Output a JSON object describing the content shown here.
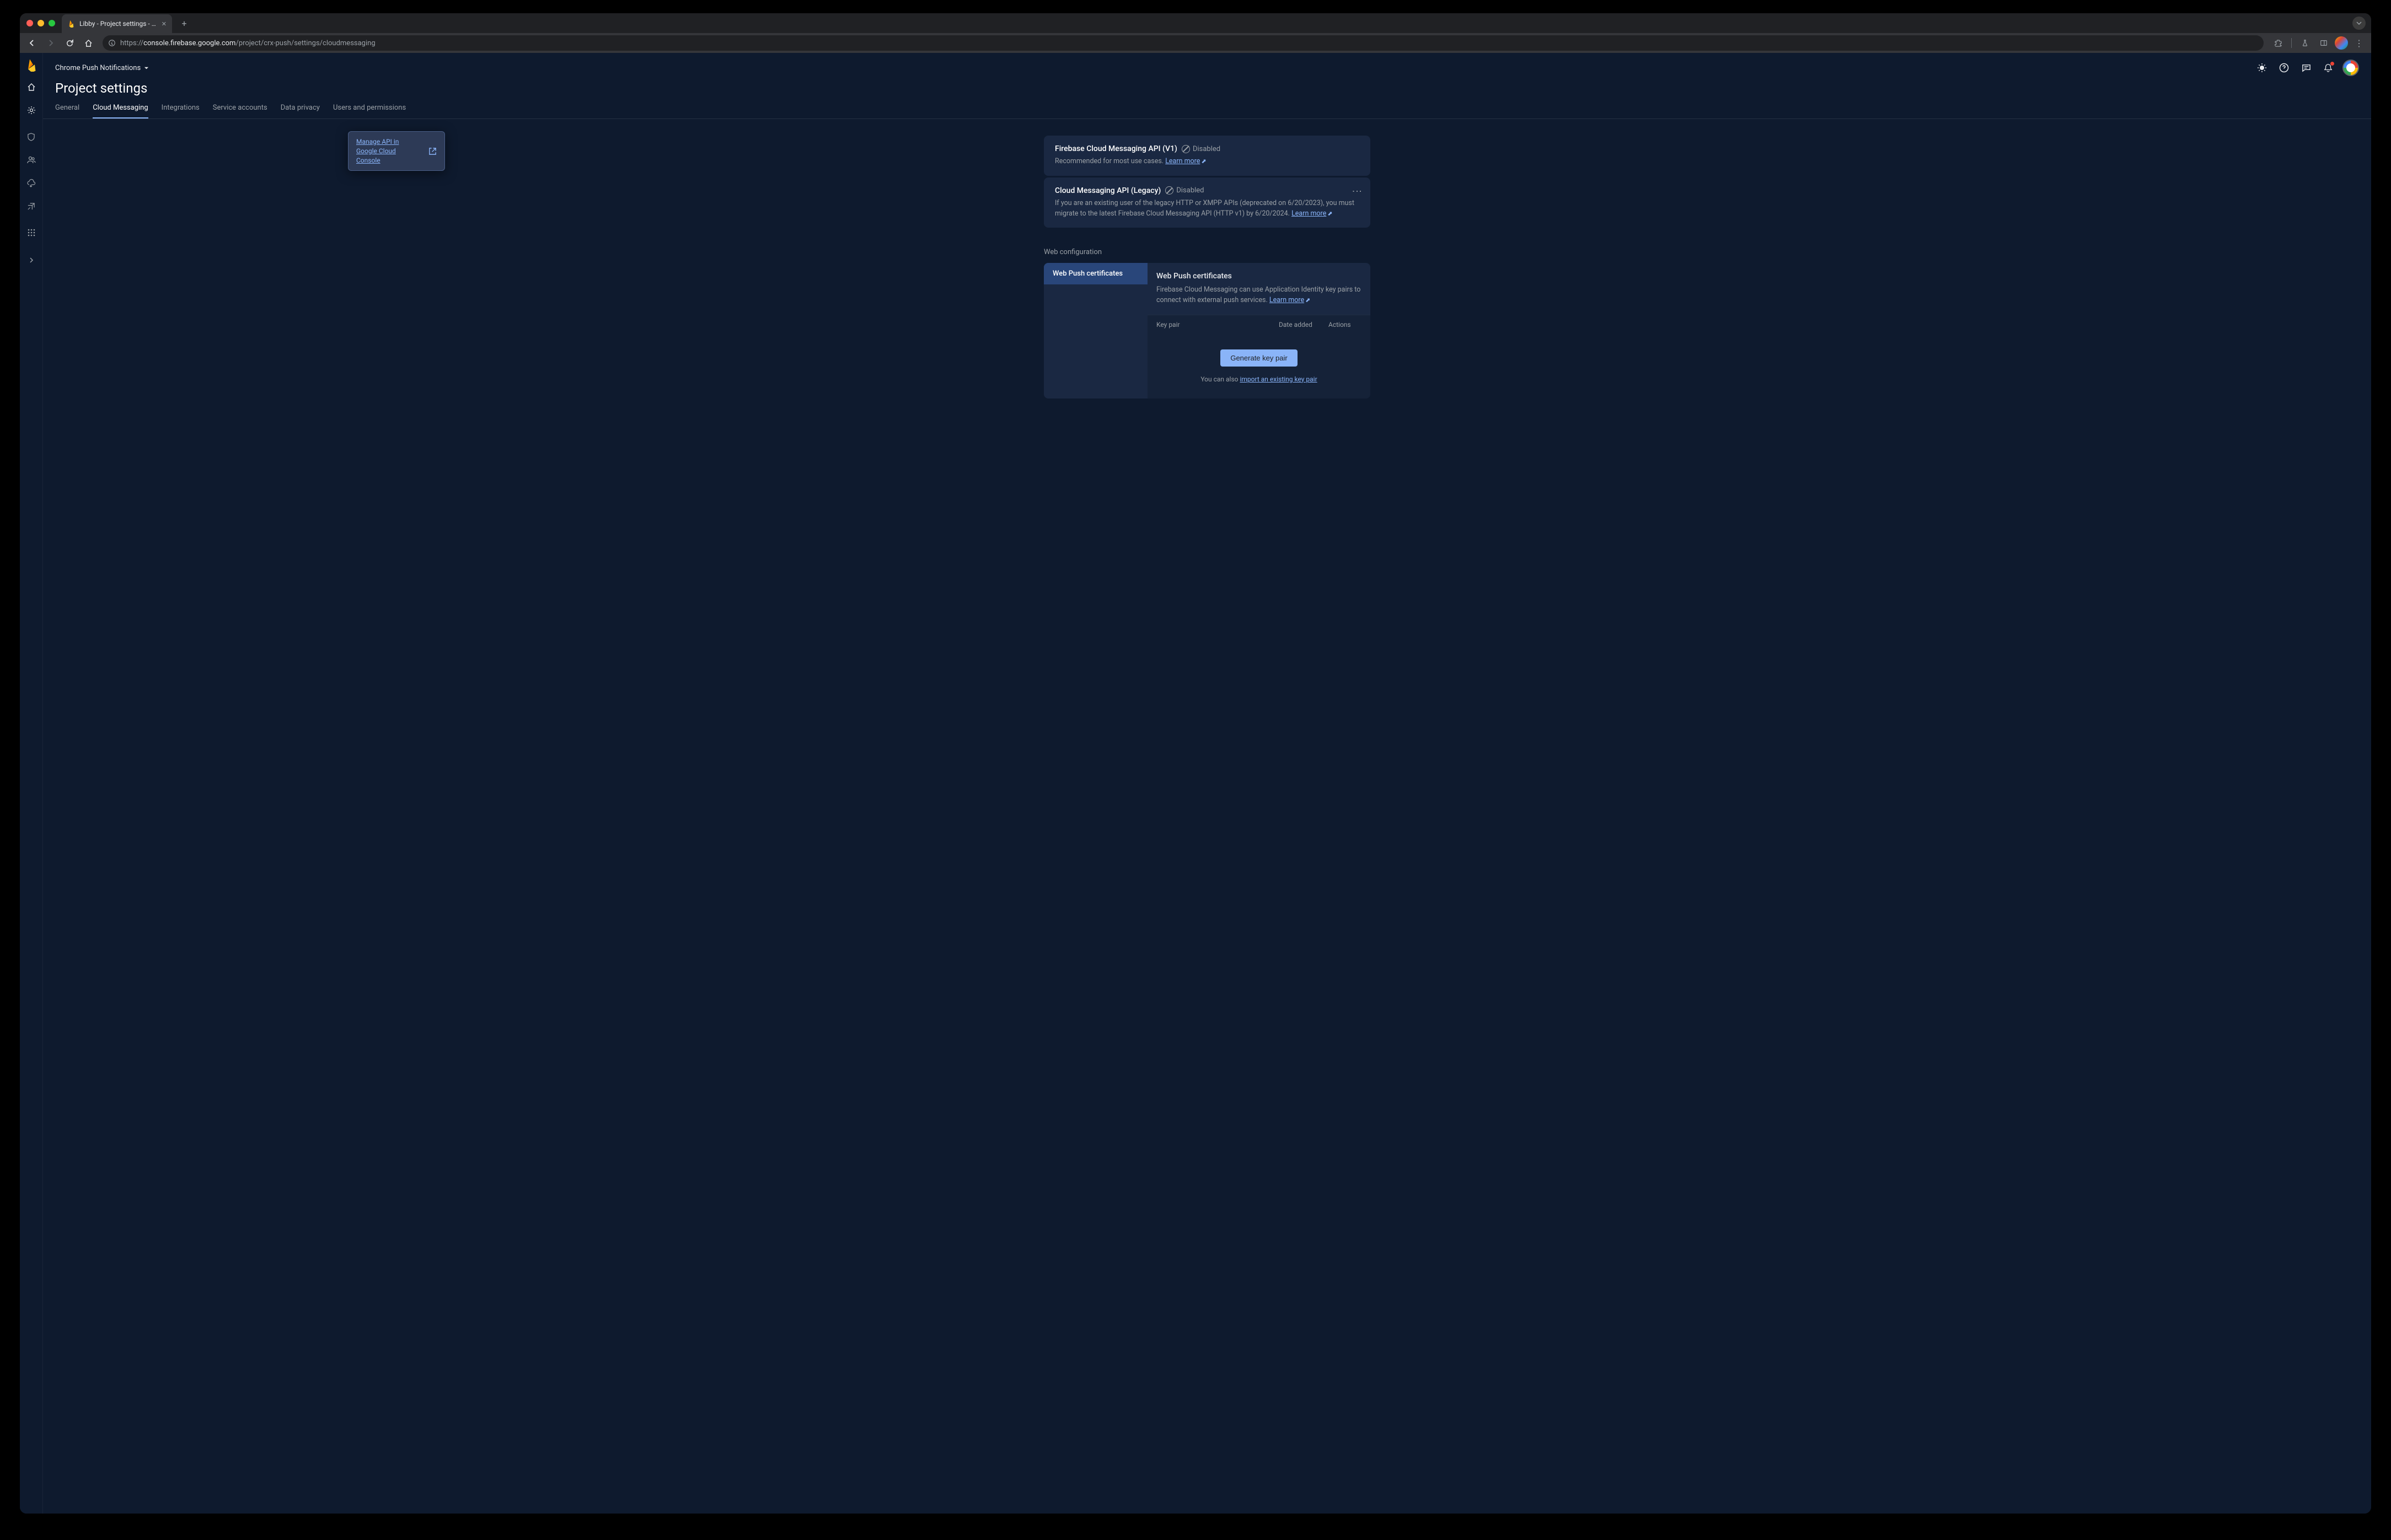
{
  "browser": {
    "tab_title": "Libby - Project settings - Fire",
    "url_display_prefix": "https://",
    "url_host": "console.firebase.google.com",
    "url_path": "/project/crx-push/settings/cloudmessaging"
  },
  "header": {
    "project_name": "Chrome Push Notifications",
    "page_title": "Project settings"
  },
  "tabs": {
    "general": "General",
    "cloud_messaging": "Cloud Messaging",
    "integrations": "Integrations",
    "service_accounts": "Service accounts",
    "data_privacy": "Data privacy",
    "users_permissions": "Users and permissions"
  },
  "v1_card": {
    "title": "Firebase Cloud Messaging API (V1)",
    "status": "Disabled",
    "description": "Recommended for most use cases.",
    "learn_more": "Learn more"
  },
  "legacy_card": {
    "title": "Cloud Messaging API (Legacy)",
    "status": "Disabled",
    "description": "If you are an existing user of the legacy HTTP or XMPP APIs (deprecated on 6/20/2023), you must migrate to the latest Firebase Cloud Messaging API (HTTP v1) by 6/20/2024.",
    "learn_more": "Learn more"
  },
  "popover": {
    "text": "Manage API in Google Cloud Console"
  },
  "web_config": {
    "section_label": "Web configuration",
    "tab_label": "Web Push certificates",
    "panel_title": "Web Push certificates",
    "panel_desc": "Firebase Cloud Messaging can use Application Identity key pairs to connect with external push services.",
    "learn_more": "Learn more",
    "th_pair": "Key pair",
    "th_date": "Date added",
    "th_actions": "Actions",
    "generate_btn": "Generate key pair",
    "import_prefix": "You can also ",
    "import_link": "import an existing key pair"
  }
}
